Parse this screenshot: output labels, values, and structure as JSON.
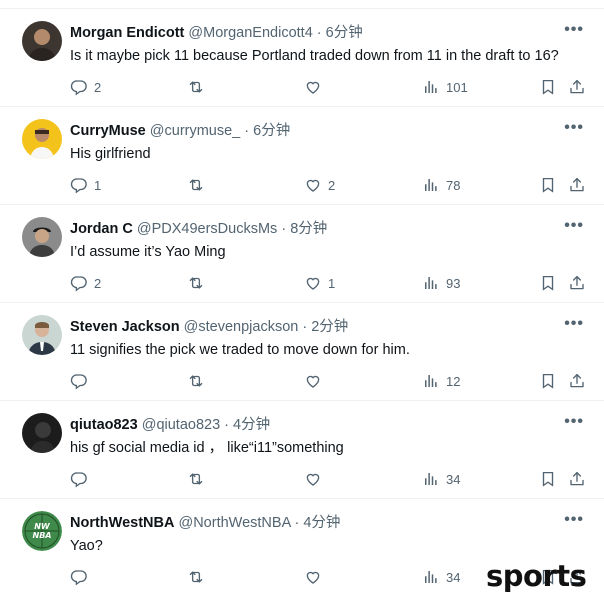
{
  "colors": {
    "muted": "#536471",
    "text": "#0f1419",
    "divider": "#eff3f4"
  },
  "tweets": [
    {
      "name": "Morgan Endicott",
      "handle": "@MorganEndicott4",
      "sep": "·",
      "time": "6分钟",
      "text": "Is it maybe pick 11 because Portland traded down from 11 in the draft to 16?",
      "replies": "2",
      "retweets": "",
      "likes": "",
      "views": "101",
      "avatar": "photo-dark"
    },
    {
      "name": "CurryMuse",
      "handle": "@currymuse_",
      "sep": "·",
      "time": "6分钟",
      "text": "His girlfriend",
      "replies": "1",
      "retweets": "",
      "likes": "2",
      "views": "78",
      "avatar": "photo-yellow"
    },
    {
      "name": "Jordan C",
      "handle": "@PDX49ersDucksMs",
      "sep": "·",
      "time": "8分钟",
      "text": "I’d assume it’s Yao Ming",
      "replies": "2",
      "retweets": "",
      "likes": "1",
      "views": "93",
      "avatar": "photo-cap"
    },
    {
      "name": "Steven Jackson",
      "handle": "@stevenpjackson",
      "sep": "·",
      "time": "2分钟",
      "text": "11 signifies the pick we traded to move down for him.",
      "replies": "",
      "retweets": "",
      "likes": "",
      "views": "12",
      "avatar": "photo-suit"
    },
    {
      "name": "qiutao823",
      "handle": "@qiutao823",
      "sep": "·",
      "time": "4分钟",
      "text": "his gf social media id ， like“i11”something",
      "replies": "",
      "retweets": "",
      "likes": "",
      "views": "34",
      "avatar": "photo-black"
    },
    {
      "name": "NorthWestNBA",
      "handle": "@NorthWestNBA",
      "sep": "·",
      "time": "4分钟",
      "text": "Yao?",
      "replies": "",
      "retweets": "",
      "likes": "",
      "views": "34",
      "avatar": "logo-nwnba",
      "avatar_text": "NW NBA"
    }
  ],
  "more_glyph": "•••",
  "watermark": "sports"
}
